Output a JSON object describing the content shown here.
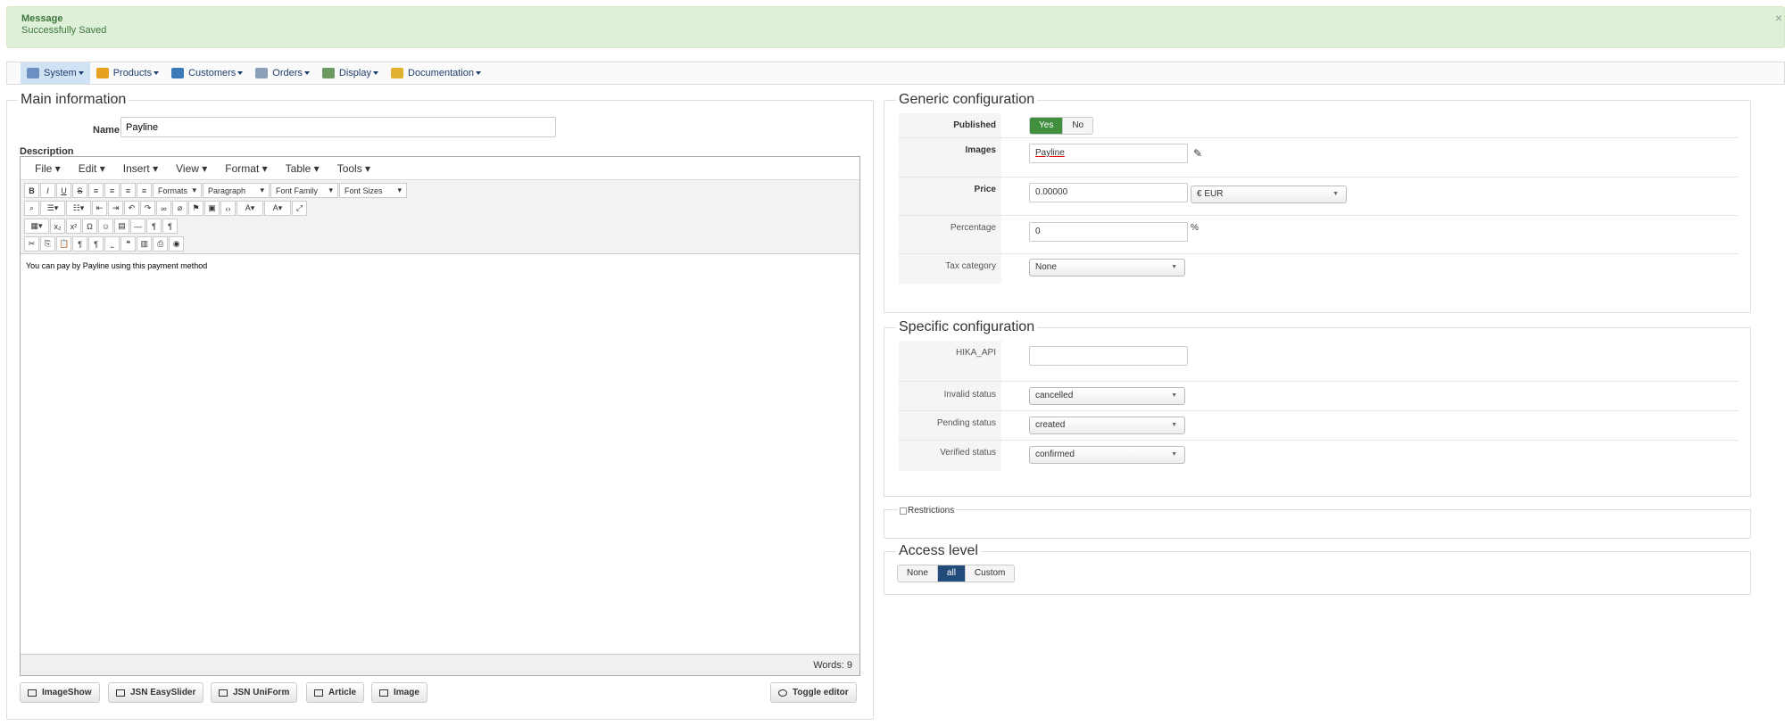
{
  "message": {
    "title": "Message",
    "text": "Successfully Saved",
    "close": "×"
  },
  "menu": [
    {
      "label": "System",
      "icon": "wrench-icon",
      "color": "#6a8fc0"
    },
    {
      "label": "Products",
      "icon": "box-icon",
      "color": "#e8a020"
    },
    {
      "label": "Customers",
      "icon": "users-icon",
      "color": "#3a7ab8"
    },
    {
      "label": "Orders",
      "icon": "cart-icon",
      "color": "#8aa0b8"
    },
    {
      "label": "Display",
      "icon": "display-icon",
      "color": "#6a9a60"
    },
    {
      "label": "Documentation",
      "icon": "help-icon",
      "color": "#e0b030"
    }
  ],
  "main": {
    "legend": "Main information",
    "name_label": "Name",
    "name_value": "Payline",
    "desc_label": "Description"
  },
  "editor": {
    "menus": [
      "File",
      "Edit",
      "Insert",
      "View",
      "Format",
      "Table",
      "Tools"
    ],
    "formats": "Formats",
    "paragraph": "Paragraph",
    "font_family": "Font Family",
    "font_sizes": "Font Sizes",
    "content": "You can pay by Payline using this payment method",
    "words": "Words: 9"
  },
  "buttons": {
    "imageshow": "ImageShow",
    "easyslider": "JSN EasySlider",
    "uniform": "JSN UniForm",
    "article": "Article",
    "image": "Image",
    "toggle": "Toggle editor"
  },
  "generic": {
    "legend": "Generic configuration",
    "published_label": "Published",
    "yes": "Yes",
    "no": "No",
    "images_label": "Images",
    "images_value": "Payline",
    "price_label": "Price",
    "price_value": "0.00000",
    "currency": "€ EUR",
    "percentage_label": "Percentage",
    "percentage_value": "0",
    "percent_sign": "%",
    "tax_label": "Tax category",
    "tax_value": "None"
  },
  "specific": {
    "legend": "Specific configuration",
    "api_label": "HIKA_API",
    "api_value": "",
    "invalid_label": "Invalid status",
    "invalid_value": "cancelled",
    "pending_label": "Pending status",
    "pending_value": "created",
    "verified_label": "Verified status",
    "verified_value": "confirmed"
  },
  "restrictions": {
    "label": "Restrictions"
  },
  "access": {
    "legend": "Access level",
    "none": "None",
    "all": "all",
    "custom": "Custom"
  }
}
